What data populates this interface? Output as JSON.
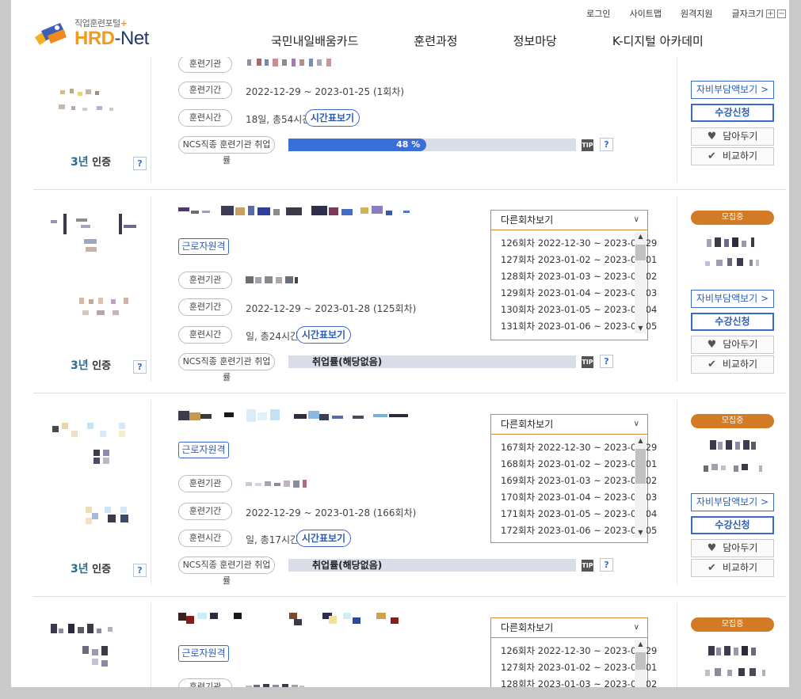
{
  "header": {
    "logo_sub": "직업훈련포털",
    "logo_plus": "+",
    "logo_hrd": "HRD",
    "logo_dash": "-",
    "logo_net": "Net",
    "utility": [
      "로그인",
      "사이트맵",
      "원격지원",
      "글자크기"
    ],
    "fontsize_plus": "+",
    "fontsize_minus": "−",
    "nav": [
      "국민내일배움카드",
      "훈련과정",
      "정보마당",
      "K-디지털 아카데미"
    ]
  },
  "common": {
    "label_org": "훈련기관",
    "label_period": "훈련기간",
    "label_time": "훈련시간",
    "label_ncs": "NCS직종 훈련기관 취업률",
    "timetable_btn": "시간표보기",
    "worker_tag": "근로자원격",
    "cert_num": "3년",
    "cert_text": "인증",
    "q": "?",
    "tip": "TIP",
    "other_rounds": "다른회차보기",
    "badge": "모집중",
    "btn_selfpay": "자비부담액보기 >",
    "btn_apply": "수강신청",
    "btn_save": "담아두기",
    "btn_compare": "비교하기",
    "no_rate": "취업률(해당없음)"
  },
  "rows": [
    {
      "period": "2022-12-29 ~ 2023-01-25 (1회차)",
      "time": "18일, 총54시간",
      "rate": 48,
      "rate_label": "48 %"
    },
    {
      "period": "2022-12-29 ~ 2023-01-28 (125회차)",
      "time": "일, 총24시간",
      "rounds": [
        "126회차 2022-12-30 ~ 2023-01-29",
        "127회차 2023-01-02 ~ 2023-02-01",
        "128회차 2023-01-03 ~ 2023-02-02",
        "129회차 2023-01-04 ~ 2023-02-03",
        "130회차 2023-01-05 ~ 2023-02-04",
        "131회차 2023-01-06 ~ 2023-02-05"
      ]
    },
    {
      "period": "2022-12-29 ~ 2023-01-28 (166회차)",
      "time": "일, 총17시간",
      "rounds": [
        "167회차 2022-12-30 ~ 2023-01-29",
        "168회차 2023-01-02 ~ 2023-02-01",
        "169회차 2023-01-03 ~ 2023-02-02",
        "170회차 2023-01-04 ~ 2023-02-03",
        "171회차 2023-01-05 ~ 2023-02-04",
        "172회차 2023-01-06 ~ 2023-02-05"
      ]
    },
    {
      "rounds": [
        "126회차 2022-12-30 ~ 2023-01-29",
        "127회차 2023-01-02 ~ 2023-02-01",
        "128회차 2023-01-03 ~ 2023-02-02"
      ]
    }
  ]
}
